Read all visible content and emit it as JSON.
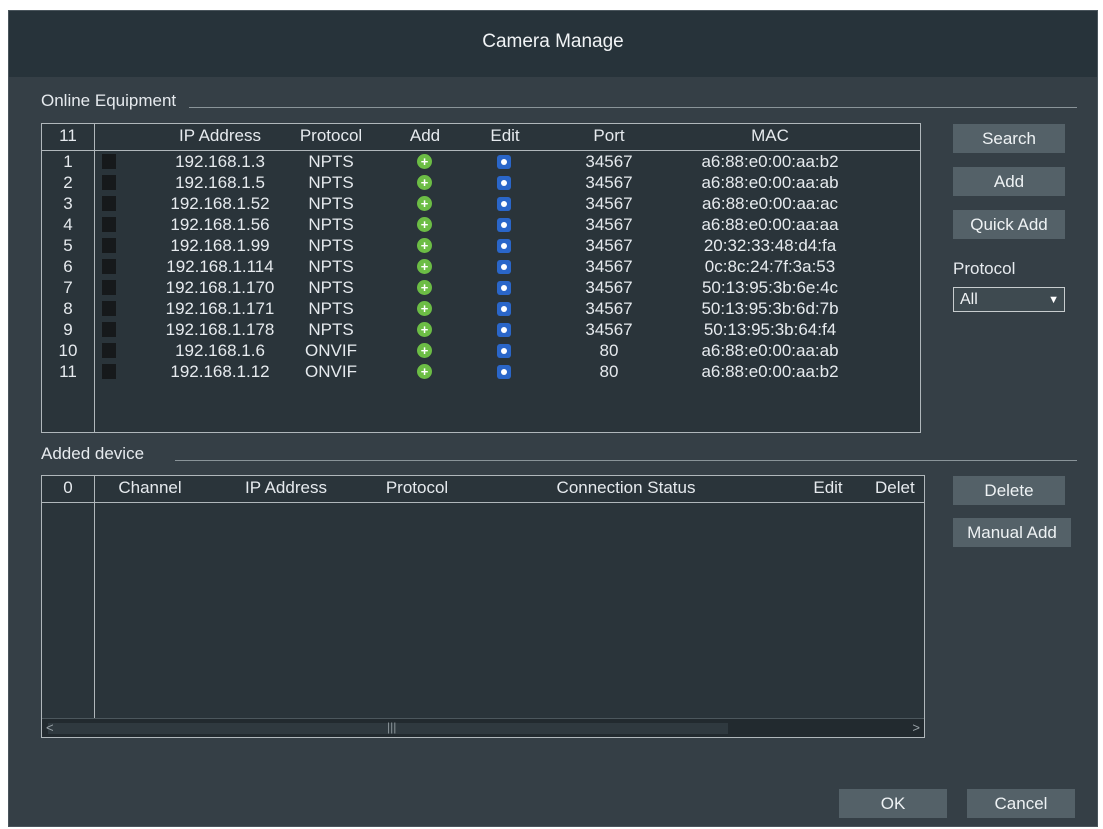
{
  "window": {
    "title": "Camera Manage"
  },
  "online": {
    "label": "Online Equipment",
    "count": "11",
    "headers": {
      "ip": "IP Address",
      "protocol": "Protocol",
      "add": "Add",
      "edit": "Edit",
      "port": "Port",
      "mac": "MAC"
    },
    "rows": [
      {
        "no": "1",
        "ip": "192.168.1.3",
        "protocol": "NPTS",
        "port": "34567",
        "mac": "a6:88:e0:00:aa:b2"
      },
      {
        "no": "2",
        "ip": "192.168.1.5",
        "protocol": "NPTS",
        "port": "34567",
        "mac": "a6:88:e0:00:aa:ab"
      },
      {
        "no": "3",
        "ip": "192.168.1.52",
        "protocol": "NPTS",
        "port": "34567",
        "mac": "a6:88:e0:00:aa:ac"
      },
      {
        "no": "4",
        "ip": "192.168.1.56",
        "protocol": "NPTS",
        "port": "34567",
        "mac": "a6:88:e0:00:aa:aa"
      },
      {
        "no": "5",
        "ip": "192.168.1.99",
        "protocol": "NPTS",
        "port": "34567",
        "mac": "20:32:33:48:d4:fa"
      },
      {
        "no": "6",
        "ip": "192.168.1.114",
        "protocol": "NPTS",
        "port": "34567",
        "mac": "0c:8c:24:7f:3a:53"
      },
      {
        "no": "7",
        "ip": "192.168.1.170",
        "protocol": "NPTS",
        "port": "34567",
        "mac": "50:13:95:3b:6e:4c"
      },
      {
        "no": "8",
        "ip": "192.168.1.171",
        "protocol": "NPTS",
        "port": "34567",
        "mac": "50:13:95:3b:6d:7b"
      },
      {
        "no": "9",
        "ip": "192.168.1.178",
        "protocol": "NPTS",
        "port": "34567",
        "mac": "50:13:95:3b:64:f4"
      },
      {
        "no": "10",
        "ip": "192.168.1.6",
        "protocol": "ONVIF",
        "port": "80",
        "mac": "a6:88:e0:00:aa:ab"
      },
      {
        "no": "11",
        "ip": "192.168.1.12",
        "protocol": "ONVIF",
        "port": "80",
        "mac": "a6:88:e0:00:aa:b2"
      }
    ]
  },
  "added": {
    "label": "Added device",
    "count": "0",
    "headers": {
      "channel": "Channel",
      "ip": "IP Address",
      "protocol": "Protocol",
      "status": "Connection Status",
      "edit": "Edit",
      "delete": "Delet"
    }
  },
  "buttons": {
    "search": "Search",
    "add": "Add",
    "quick_add": "Quick Add",
    "delete": "Delete",
    "manual_add": "Manual Add",
    "ok": "OK",
    "cancel": "Cancel"
  },
  "protocol_filter": {
    "label": "Protocol",
    "selected": "All"
  },
  "scrollbar": {
    "left": "<",
    "right": ">",
    "grip": "|||"
  },
  "icons": {
    "add": "add-icon",
    "edit": "edit-icon"
  },
  "colors": {
    "add_icon": "#6cbd45",
    "edit_icon": "#2a66c9",
    "button": "#546168",
    "background": "#353f46"
  }
}
